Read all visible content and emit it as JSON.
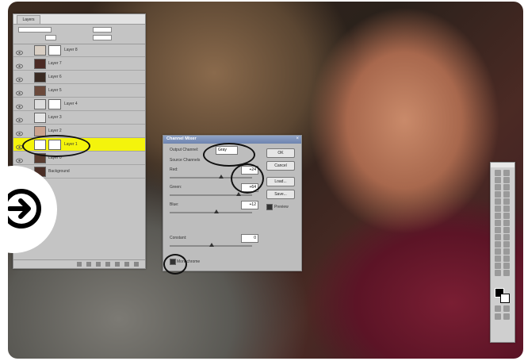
{
  "layers_panel": {
    "tab_label": "Layers",
    "rows": [
      {
        "label": "Layer 8",
        "has_mask": true,
        "thumb": "#d9cfc4"
      },
      {
        "label": "Layer 7",
        "has_mask": false,
        "thumb": "#4b2a24"
      },
      {
        "label": "Layer 6",
        "has_mask": false,
        "thumb": "#3a2a22"
      },
      {
        "label": "Layer 5",
        "has_mask": false,
        "thumb": "#6b4a3c"
      },
      {
        "label": "Layer 4",
        "has_mask": true,
        "thumb": "#dddddd"
      },
      {
        "label": "Layer 3",
        "has_mask": false,
        "thumb": "#e5e5e5"
      },
      {
        "label": "Layer 2",
        "has_mask": false,
        "thumb": "#caa28e"
      },
      {
        "label": "Layer 1",
        "has_mask": true,
        "thumb": "#ffffff",
        "selected": true
      },
      {
        "label": "Layer 0",
        "has_mask": false,
        "thumb": "#5a3c30"
      },
      {
        "label": "Background",
        "has_mask": false,
        "thumb": "#4a2e26"
      }
    ]
  },
  "dialog": {
    "title": "Channel Mixer",
    "output_channel_label": "Output Channel:",
    "output_channel_value": "Gray",
    "source_channels_label": "Source Channels",
    "red_label": "Red:",
    "red_value": "+24",
    "green_label": "Green:",
    "green_value": "+64",
    "blue_label": "Blue:",
    "blue_value": "+12",
    "constant_label": "Constant:",
    "constant_value": "0",
    "monochrome_label": "Monochrome",
    "ok_label": "OK",
    "cancel_label": "Cancel",
    "load_label": "Load...",
    "save_label": "Save...",
    "preview_label": "Preview",
    "preview_checked": true,
    "monochrome_checked": true
  },
  "colors": {
    "selected_row": "#f4f40c",
    "panel_bg": "#c4c4c4",
    "dialog_title": "#7489b5"
  }
}
